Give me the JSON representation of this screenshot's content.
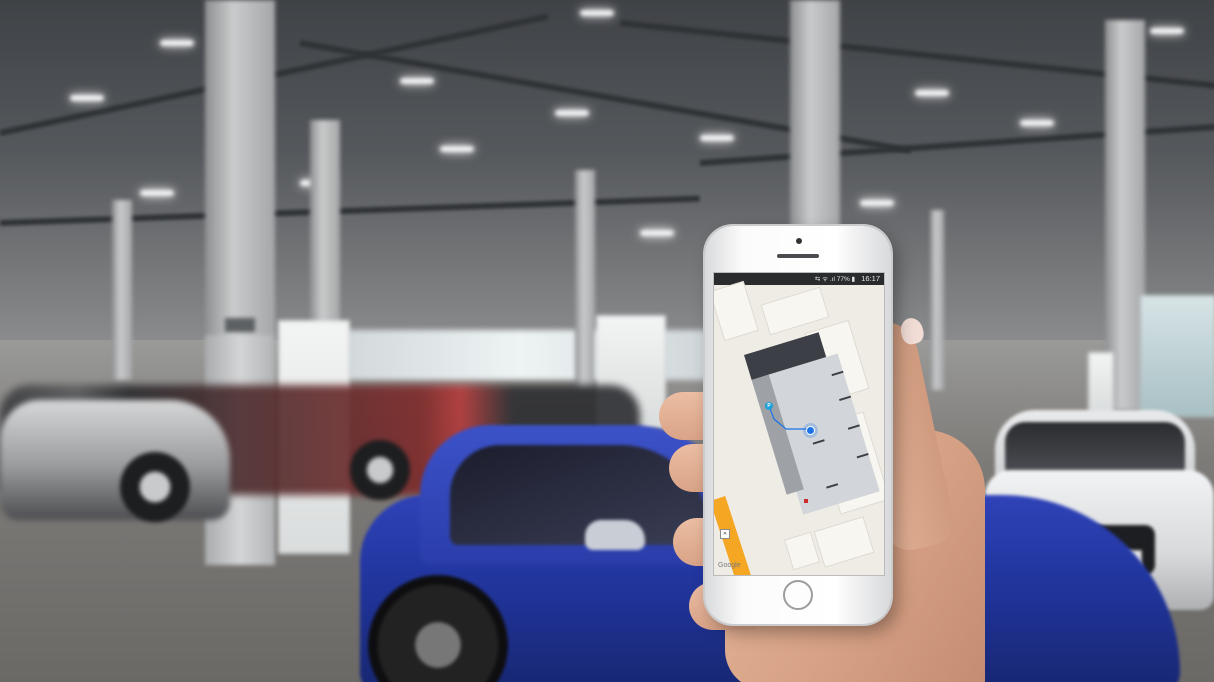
{
  "scene": {
    "description_free": true
  },
  "phone": {
    "status_bar": {
      "icons": "⇆ ᯤ .ıl 77% ▮",
      "time": "16:17"
    },
    "map": {
      "attribution": "Google",
      "location_badge": "P"
    }
  },
  "colors": {
    "blue_car": "#2236a0",
    "map_route": "#1a73e8",
    "road": "#f5a623"
  }
}
